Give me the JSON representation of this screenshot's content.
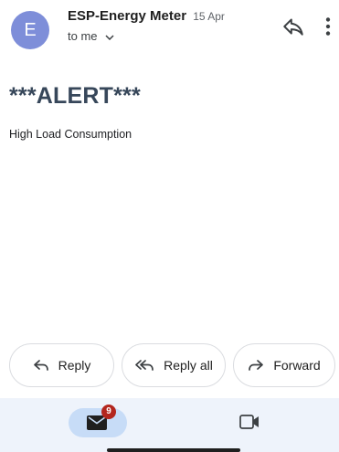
{
  "header": {
    "avatar_letter": "E",
    "sender": "ESP-Energy Meter",
    "date": "15 Apr",
    "to": "to me"
  },
  "message": {
    "subject": "***ALERT***",
    "body": "High Load Consumption"
  },
  "actions": {
    "reply": "Reply",
    "reply_all": "Reply all",
    "forward": "Forward"
  },
  "nav": {
    "mail_badge": "9"
  },
  "colors": {
    "avatar": "#7e8ed9",
    "subject": "#37475a",
    "nav_bg": "#eef3fb",
    "mail_pill": "#c7dcf7",
    "badge": "#b3261e"
  },
  "icons": [
    "reply-icon",
    "more-vert-icon",
    "chevron-down-icon",
    "reply-all-icon",
    "forward-icon",
    "mail-icon",
    "video-icon"
  ]
}
